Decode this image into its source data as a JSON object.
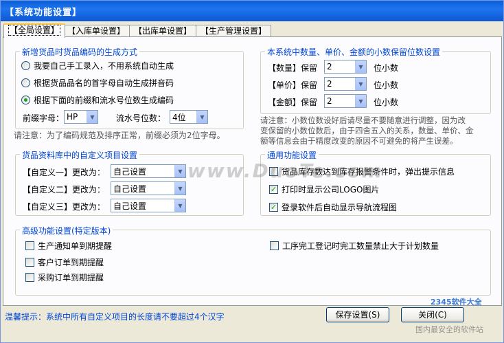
{
  "window": {
    "title": "【系统功能设置】"
  },
  "tabs": [
    {
      "label": "【全局设置】",
      "active": true
    },
    {
      "label": "【入库单设置】"
    },
    {
      "label": "【出库单设置】"
    },
    {
      "label": "【生产管理设置】"
    }
  ],
  "code_gen": {
    "title": "新增货品时货品编码的生成方式",
    "options": [
      {
        "label": "我要自己手工录入，不用系统自动生成",
        "selected": false
      },
      {
        "label": "根据货品品名的首字母自动生成拼音码",
        "selected": false
      },
      {
        "label": "根据下面的前缀和流水号位数生成编码",
        "selected": true
      }
    ],
    "prefix_label": "前缀字母：",
    "prefix_value": "HP",
    "serial_label": "流水号位数：",
    "serial_value": "4位",
    "note": "请注意：为了编码规范及排序正常，前缀必须为2位字母。"
  },
  "decimals": {
    "title": "本系统中数量、单价、金额的小数保留位数设置",
    "rows": [
      {
        "label": "【数量】保留",
        "value": "2",
        "unit": "位小数"
      },
      {
        "label": "【单价】保留",
        "value": "2",
        "unit": "位小数"
      },
      {
        "label": "【金额】保留",
        "value": "2",
        "unit": "位小数"
      }
    ],
    "note_line1": "请注意：小数位数设好后请尽量不要随意进行调整，因为改",
    "note_line2": "变保留的小数位数后，由于四舍五入的关系，数量、单价、金",
    "note_line3": "额等信息会由于精度改变的原因不可避免的将产生误差。"
  },
  "custom_fields": {
    "title": "货品资料库中的自定义项目设置",
    "rows": [
      {
        "label": "【自定义一】更改为：",
        "value": "自己设置"
      },
      {
        "label": "【自定义二】更改为：",
        "value": "自己设置"
      },
      {
        "label": "【自定义三】更改为：",
        "value": "自己设置"
      }
    ]
  },
  "general": {
    "title": "通用功能设置",
    "items": [
      {
        "label": "货品库存数达到库存报警条件时，弹出提示信息",
        "checked": false
      },
      {
        "label": "打印时显示公司LOGO图片",
        "checked": true
      },
      {
        "label": "登录软件后自动显示导航流程图",
        "checked": true
      }
    ]
  },
  "advanced": {
    "title": "高级功能设置(特定版本)",
    "items": [
      {
        "label": "生产通知单到期提醒",
        "checked": false
      },
      {
        "label": "客户订单到期提醒",
        "checked": false
      },
      {
        "label": "采购订单到期提醒",
        "checked": false
      },
      {
        "label": "工序完工登记时完工数量禁止大于计划数量",
        "checked": false
      }
    ]
  },
  "footer": {
    "tip": "温馨提示：系统中所有自定义项目的长度请不要超过4个汉字",
    "save_label": "保存设置(S)",
    "close_label": "关闭(C)"
  },
  "watermarks": {
    "center": "www.DuoTe.com",
    "corner_top": "2345软件大全",
    "corner_bottom": "国内最安全的软件站"
  },
  "icons": {
    "dropdown": "chevron-down-icon",
    "check": "check-icon"
  },
  "colors": {
    "accent": "#0046D5",
    "check": "#21A121",
    "title_bar": "#0A5FD8"
  }
}
